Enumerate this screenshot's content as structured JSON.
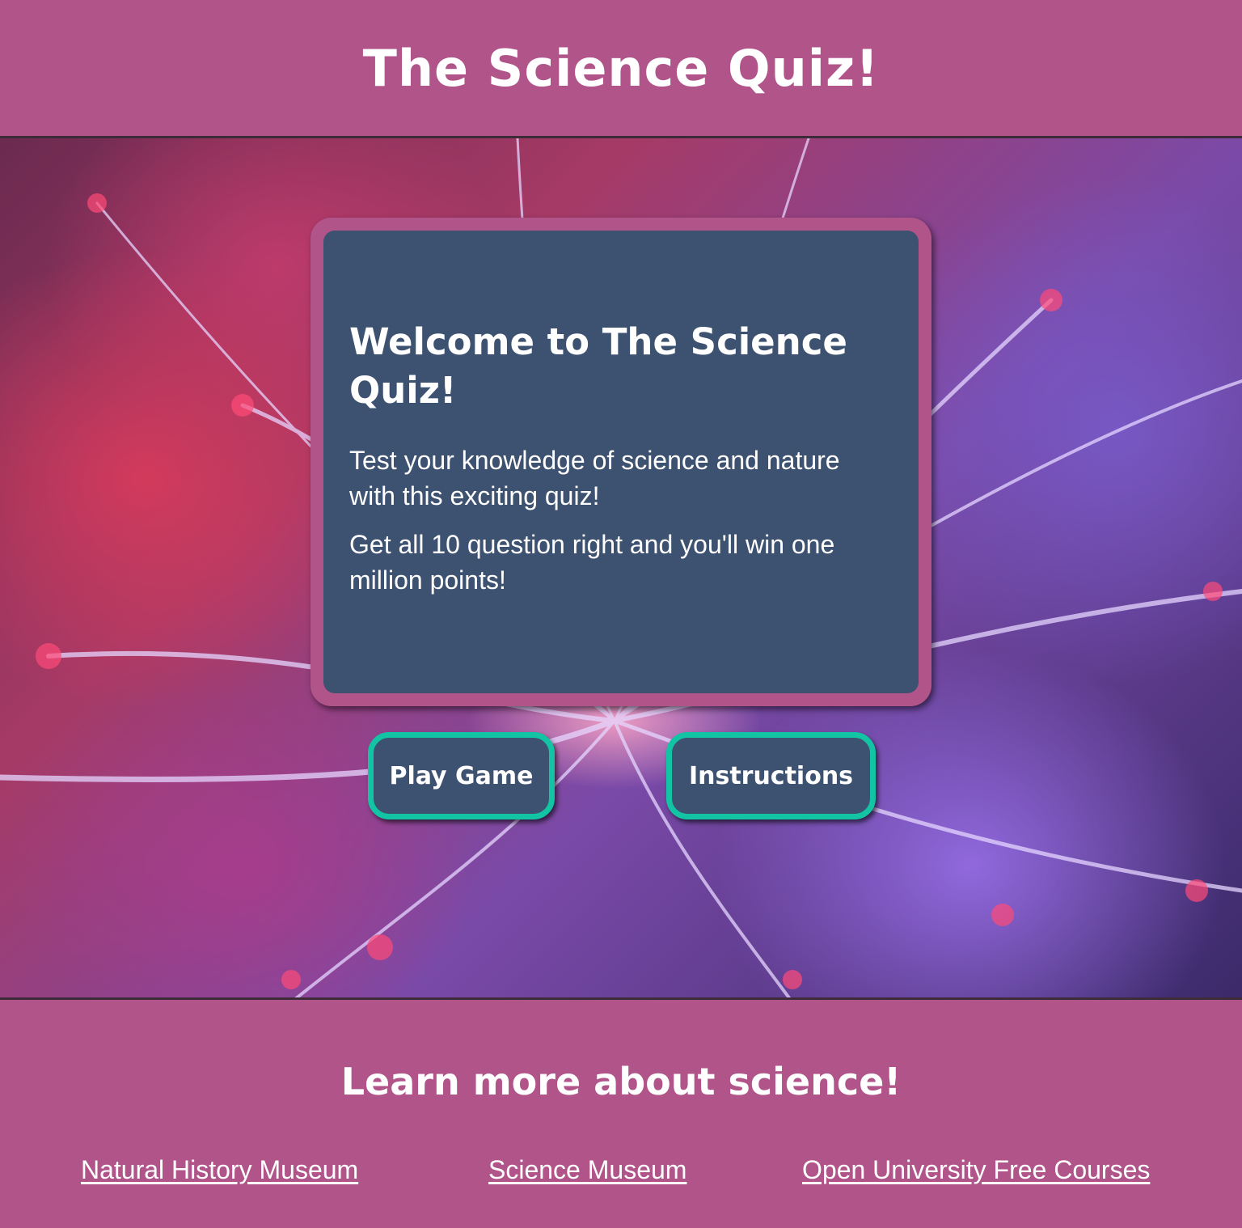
{
  "header": {
    "title": "The Science Quiz!"
  },
  "welcome": {
    "heading": "Welcome to The Science Quiz!",
    "paragraph_1": "Test your knowledge of science and nature with this exciting quiz!",
    "paragraph_2": "Get all 10 question right and you'll win one million points!"
  },
  "buttons": {
    "play_label": "Play Game",
    "instructions_label": "Instructions"
  },
  "footer": {
    "heading": "Learn more about science!",
    "links": [
      {
        "label": "Natural History Museum"
      },
      {
        "label": "Science Museum"
      },
      {
        "label": "Open University Free Courses"
      }
    ]
  },
  "colors": {
    "brand_pink": "#b0548a",
    "card_blue": "#3d5170",
    "button_border_teal": "#12c4a4",
    "text_white": "#ffffff"
  }
}
